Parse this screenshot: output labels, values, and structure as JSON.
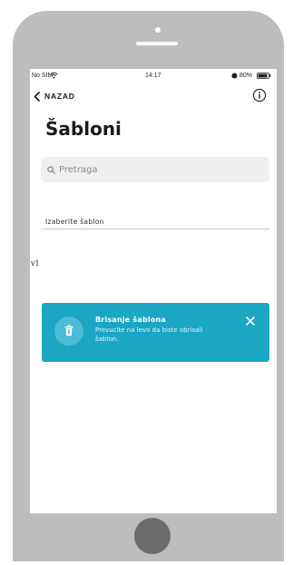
{
  "status_bar": {
    "carrier": "No SIM",
    "time": "14:17",
    "battery": "80%"
  },
  "nav": {
    "back_label": "NAZAD",
    "back_icon": "chevron-left-icon",
    "info_icon": "info-icon"
  },
  "page": {
    "title": "Šabloni"
  },
  "search": {
    "placeholder": "Pretraga",
    "value": ""
  },
  "templates": {
    "section_label": "Izaberite šablon",
    "items": [
      {
        "label": "v1"
      }
    ]
  },
  "hint": {
    "title": "Brisanje šablona",
    "text": "Prevucite na levo da biste obrisali šablon.",
    "icon": "trash-icon",
    "close_icon": "close-icon"
  },
  "colors": {
    "accent": "#1ba6c4",
    "phone_frame": "#bdbdbd",
    "home_button": "#6b6b6b"
  }
}
